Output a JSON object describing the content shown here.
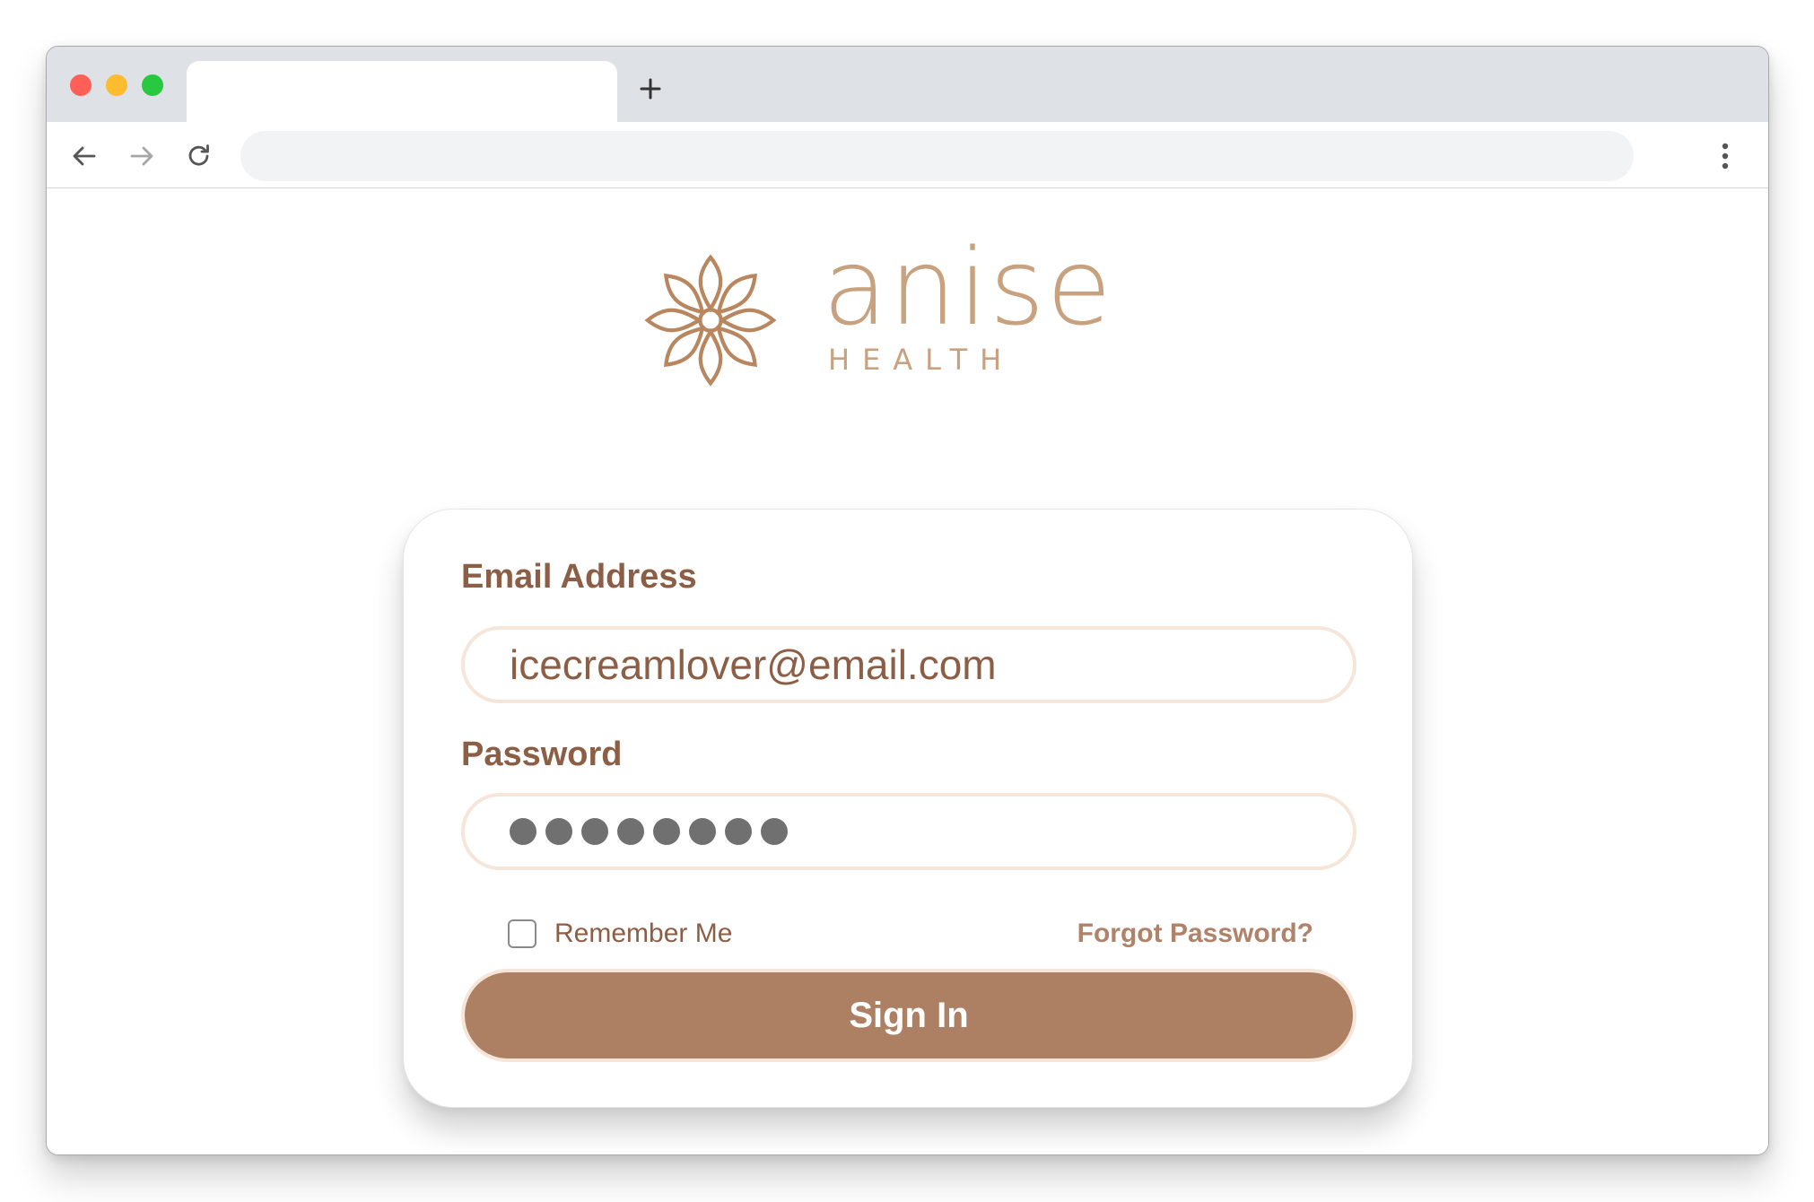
{
  "browser": {
    "tab_title": "",
    "new_tab_icon": "plus-icon",
    "address": "",
    "back_icon": "arrow-left-icon",
    "forward_icon": "arrow-right-icon",
    "reload_icon": "reload-icon",
    "menu_icon": "kebab-menu-icon"
  },
  "brand": {
    "name": "anise",
    "tagline": "HEALTH",
    "logo_icon": "flower-icon",
    "color": "#c8a17f"
  },
  "login": {
    "email_label": "Email Address",
    "email_value": "icecreamlover@email.com",
    "password_label": "Password",
    "password_mask_count": 8,
    "remember_label": "Remember Me",
    "remember_checked": false,
    "forgot_label": "Forgot Password?",
    "signin_label": "Sign In",
    "accent_color": "#ae8063",
    "label_color": "#8c5e46"
  }
}
